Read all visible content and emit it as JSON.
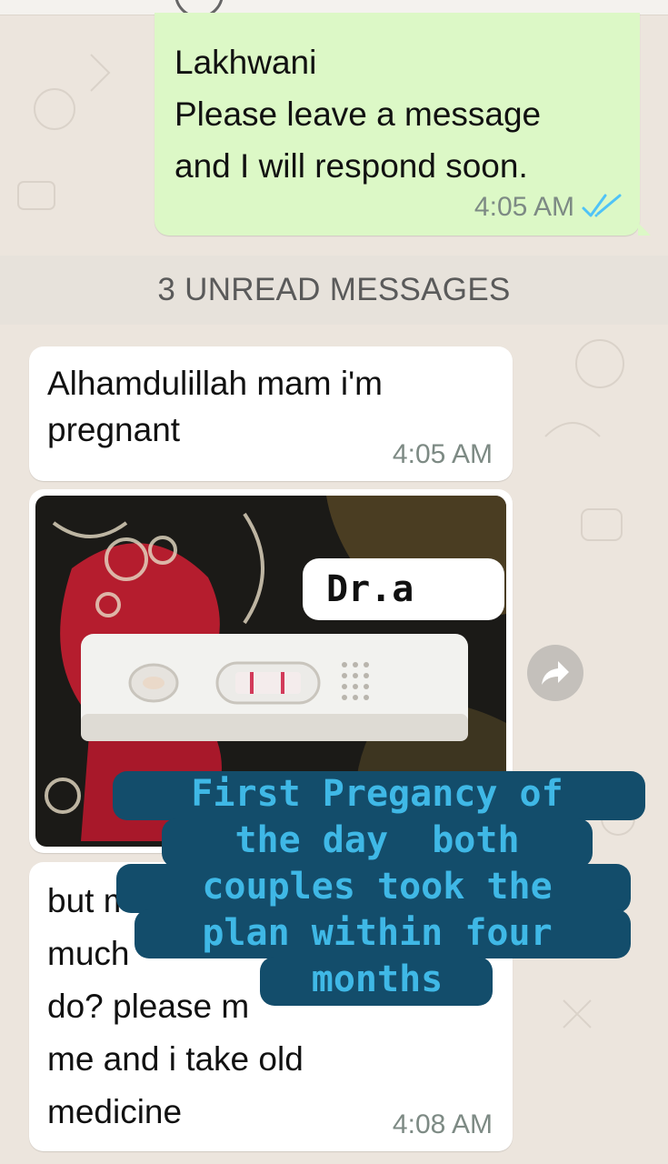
{
  "chat": {
    "outgoing_message": {
      "lines": [
        "Lakhwani",
        "Please leave a message",
        "and I will respond soon."
      ],
      "time": "4:05 AM",
      "status_icon": "double-check-read-icon"
    },
    "unread_divider": "3 UNREAD MESSAGES",
    "incoming_messages": [
      {
        "lines": [
          "Alhamdulillah mam i'm",
          "pregnant"
        ],
        "time": "4:05 AM"
      },
      {
        "type": "image",
        "image_desc_icon": "pregnancy-test-photo"
      },
      {
        "lines": [
          "but m",
          "much",
          "do? please m",
          "me and i take old",
          "medicine"
        ],
        "time": "4:08 AM"
      }
    ]
  },
  "overlays": {
    "watermark": "Dr.a",
    "caption_lines": [
      "First Pregancy of",
      "the day  both",
      "couples took the",
      "plan within four",
      "months"
    ]
  },
  "colors": {
    "wallpaper": "#ece5dd",
    "outgoing_bubble": "#dcf8c6",
    "incoming_bubble": "#ffffff",
    "read_ticks": "#4fc3f7",
    "caption_bg": "#134d6b",
    "caption_text": "#3fb8e6"
  }
}
